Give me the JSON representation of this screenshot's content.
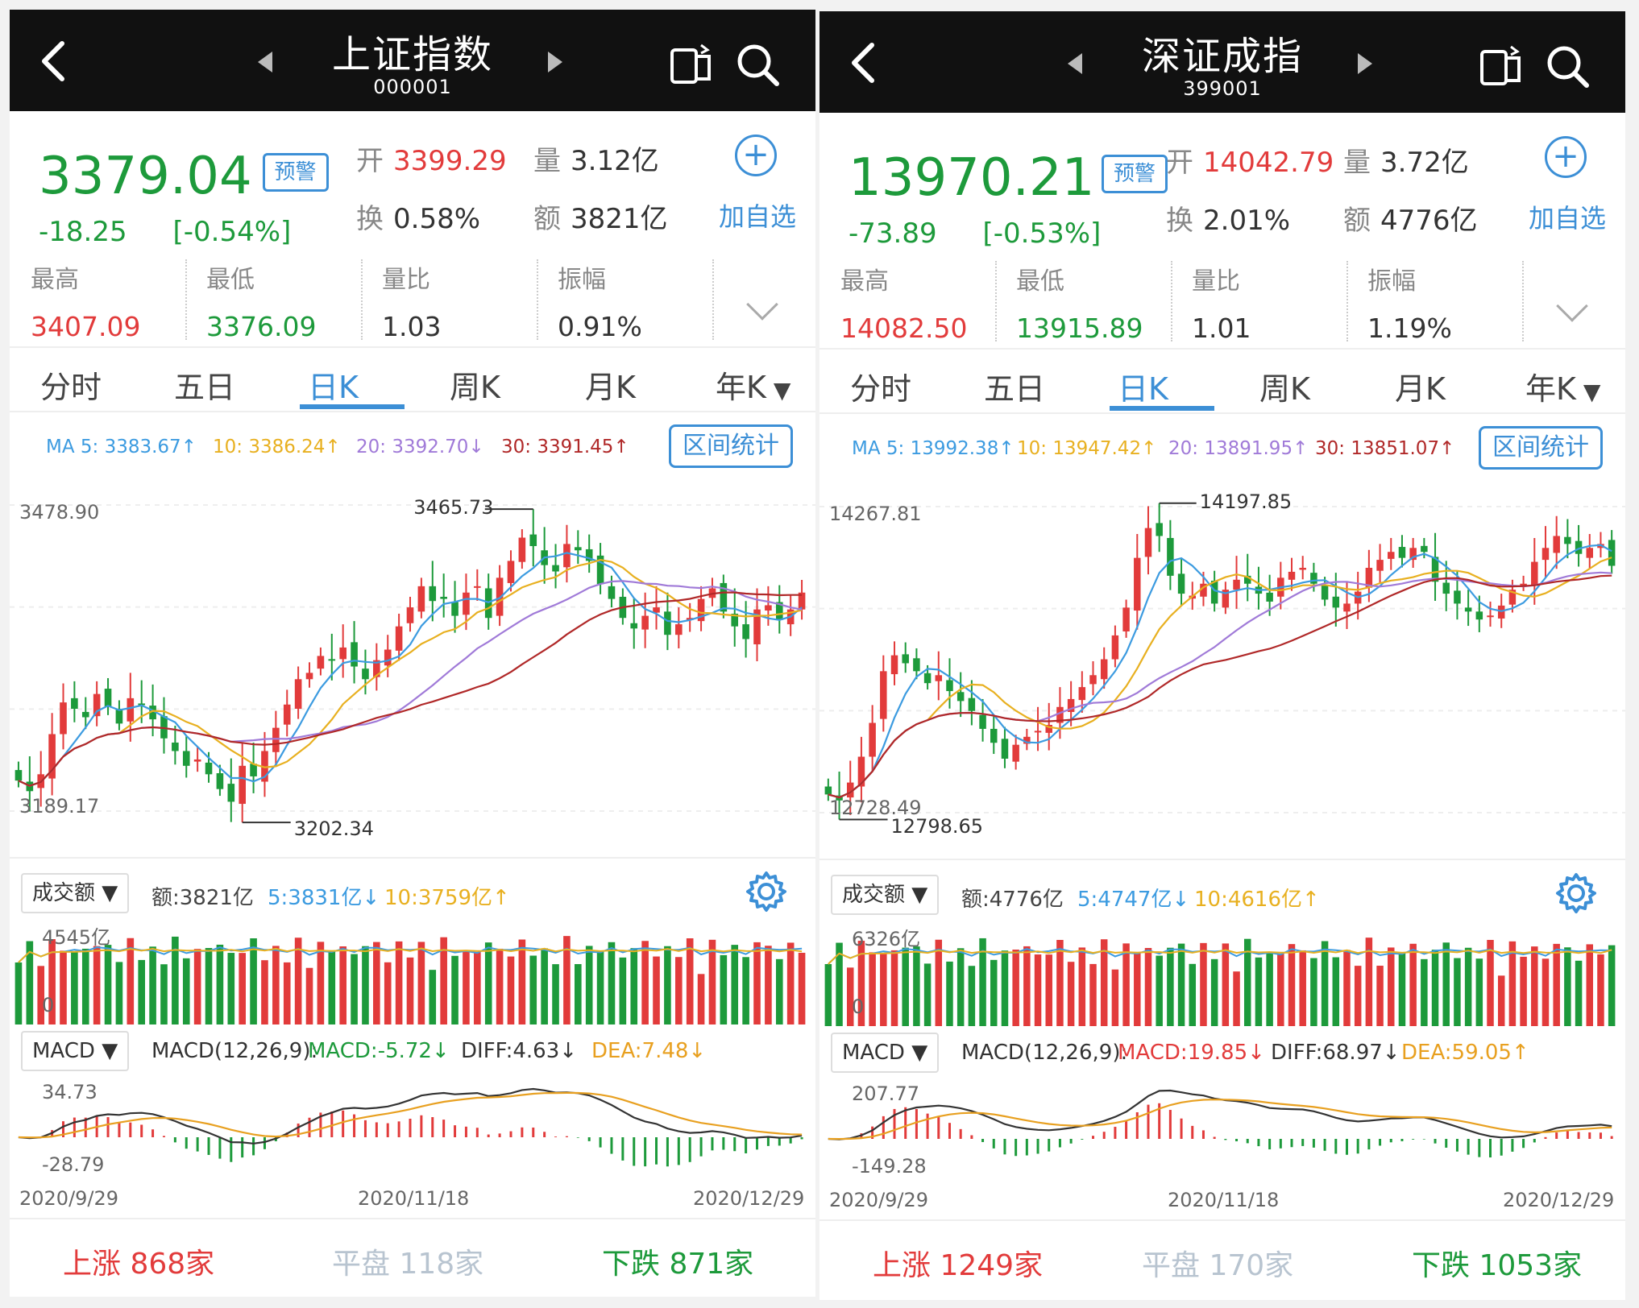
{
  "panels": [
    {
      "title": "上证指数",
      "code": "000001",
      "price": "3379.04",
      "warn": "预警",
      "change": "-18.25",
      "change_pct": "[-0.54%]",
      "open_label": "开",
      "open": "3399.29",
      "vol_label": "量",
      "vol": "3.12亿",
      "turn_label": "换",
      "turn": "0.58%",
      "amt_label": "额",
      "amt": "3821亿",
      "add_fav": "加自选",
      "stats": [
        {
          "label": "最高",
          "value": "3407.09",
          "color": "red"
        },
        {
          "label": "最低",
          "value": "3376.09",
          "color": "green"
        },
        {
          "label": "量比",
          "value": "1.03",
          "color": "plain"
        },
        {
          "label": "振幅",
          "value": "0.91%",
          "color": "plain"
        }
      ],
      "tabs": [
        "分时",
        "五日",
        "日K",
        "周K",
        "月K",
        "年K"
      ],
      "active_tab": "日K",
      "ma": [
        "MA 5: 3383.67↑",
        "10: 3386.24↑",
        "20: 3392.70↓",
        "30: 3391.45↑"
      ],
      "range_button": "区间统计",
      "axis_top": "3478.90",
      "axis_bottom": "3189.17",
      "high_label": "3465.73",
      "low_label": "3202.34",
      "vol_dropdown": "成交额",
      "vol_amt": "额:3821亿",
      "vol_ma5": "5:3831亿↓",
      "vol_ma10": "10:3759亿↑",
      "vol_axis": "4545亿",
      "vol_zero": "0",
      "macd_dropdown": "MACD",
      "macd_params": "MACD(12,26,9):",
      "macd_val": "MACD:-5.72↓",
      "diff_val": "DIFF:4.63↓",
      "dea_val": "DEA:7.48↓",
      "macd_top": "34.73",
      "macd_bottom": "-28.79",
      "dates": [
        "2020/9/29",
        "2020/11/18",
        "2020/12/29"
      ],
      "up_label": "上涨",
      "up_count": "868家",
      "flat_label": "平盘",
      "flat_count": "118家",
      "down_label": "下跌",
      "down_count": "871家"
    },
    {
      "title": "深证成指",
      "code": "399001",
      "price": "13970.21",
      "warn": "预警",
      "change": "-73.89",
      "change_pct": "[-0.53%]",
      "open_label": "开",
      "open": "14042.79",
      "vol_label": "量",
      "vol": "3.72亿",
      "turn_label": "换",
      "turn": "2.01%",
      "amt_label": "额",
      "amt": "4776亿",
      "add_fav": "加自选",
      "stats": [
        {
          "label": "最高",
          "value": "14082.50",
          "color": "red"
        },
        {
          "label": "最低",
          "value": "13915.89",
          "color": "green"
        },
        {
          "label": "量比",
          "value": "1.01",
          "color": "plain"
        },
        {
          "label": "振幅",
          "value": "1.19%",
          "color": "plain"
        }
      ],
      "tabs": [
        "分时",
        "五日",
        "日K",
        "周K",
        "月K",
        "年K"
      ],
      "active_tab": "日K",
      "ma": [
        "MA 5: 13992.38↑",
        "10: 13947.42↑",
        "20: 13891.95↑",
        "30: 13851.07↑"
      ],
      "range_button": "区间统计",
      "axis_top": "14267.81",
      "axis_bottom": "12728.49",
      "high_label": "14197.85",
      "low_label": "12798.65",
      "vol_dropdown": "成交额",
      "vol_amt": "额:4776亿",
      "vol_ma5": "5:4747亿↓",
      "vol_ma10": "10:4616亿↑",
      "vol_axis": "6326亿",
      "vol_zero": "0",
      "macd_dropdown": "MACD",
      "macd_params": "MACD(12,26,9):",
      "macd_val": "MACD:19.85↓",
      "diff_val": "DIFF:68.97↓",
      "dea_val": "DEA:59.05↑",
      "macd_top": "207.77",
      "macd_bottom": "-149.28",
      "dates": [
        "2020/9/29",
        "2020/11/18",
        "2020/12/29"
      ],
      "up_label": "上涨",
      "up_count": "1249家",
      "flat_label": "平盘",
      "flat_count": "170家",
      "down_label": "下跌",
      "down_count": "1053家"
    }
  ],
  "colors": {
    "up": "#e23b3b",
    "down": "#1d9a3b",
    "accent": "#3c8fd6",
    "ma5": "#3c9be0",
    "ma10": "#e8b020",
    "ma20": "#a07ad8",
    "ma30": "#b02828",
    "dif": "#333333",
    "dea": "#e8a020"
  },
  "chart_data": [
    {
      "type": "candlestick",
      "title": "上证指数 日K",
      "ylim": [
        3189.17,
        3478.9
      ],
      "x_range": [
        "2020/9/29",
        "2020/12/29"
      ],
      "close": [
        3218,
        3208,
        3224,
        3262,
        3292,
        3286,
        3278,
        3300,
        3288,
        3272,
        3296,
        3290,
        3276,
        3258,
        3246,
        3232,
        3238,
        3224,
        3210,
        3198,
        3232,
        3222,
        3246,
        3268,
        3290,
        3314,
        3320,
        3336,
        3332,
        3344,
        3326,
        3314,
        3332,
        3342,
        3364,
        3382,
        3402,
        3388,
        3390,
        3374,
        3396,
        3402,
        3372,
        3410,
        3426,
        3448,
        3440,
        3422,
        3416,
        3442,
        3436,
        3426,
        3404,
        3390,
        3372,
        3362,
        3374,
        3382,
        3356,
        3366,
        3372,
        3390,
        3400,
        3378,
        3364,
        3352,
        3380,
        3384,
        3370,
        3380,
        3396
      ],
      "ma_series": [
        {
          "name": "MA5",
          "color": "ma5"
        },
        {
          "name": "MA10",
          "color": "ma10"
        },
        {
          "name": "MA20",
          "color": "ma20"
        },
        {
          "name": "MA30",
          "color": "ma30"
        }
      ]
    },
    {
      "type": "candlestick",
      "title": "深证成指 日K",
      "ylim": [
        12728.49,
        14267.81
      ],
      "x_range": [
        "2020/9/29",
        "2020/12/29"
      ],
      "close": [
        12820,
        12790,
        12880,
        13010,
        13180,
        13440,
        13520,
        13480,
        13440,
        13380,
        13420,
        13340,
        13290,
        13240,
        13150,
        13080,
        13000,
        13070,
        13110,
        13140,
        13170,
        13260,
        13300,
        13360,
        13420,
        13500,
        13620,
        13760,
        14010,
        14160,
        14120,
        13920,
        13830,
        13820,
        13880,
        13780,
        13850,
        13900,
        13880,
        13830,
        13790,
        13910,
        13940,
        13960,
        13880,
        13800,
        13760,
        13780,
        13840,
        13960,
        14000,
        14040,
        14010,
        14060,
        14040,
        13890,
        13830,
        13780,
        13740,
        13700,
        13720,
        13770,
        13850,
        13880,
        13990,
        14060,
        14120,
        14080,
        14030,
        14060,
        14080,
        13970
      ],
      "ma_series": [
        {
          "name": "MA5",
          "color": "ma5"
        },
        {
          "name": "MA10",
          "color": "ma10"
        },
        {
          "name": "MA20",
          "color": "ma20"
        },
        {
          "name": "MA30",
          "color": "ma30"
        }
      ]
    }
  ]
}
